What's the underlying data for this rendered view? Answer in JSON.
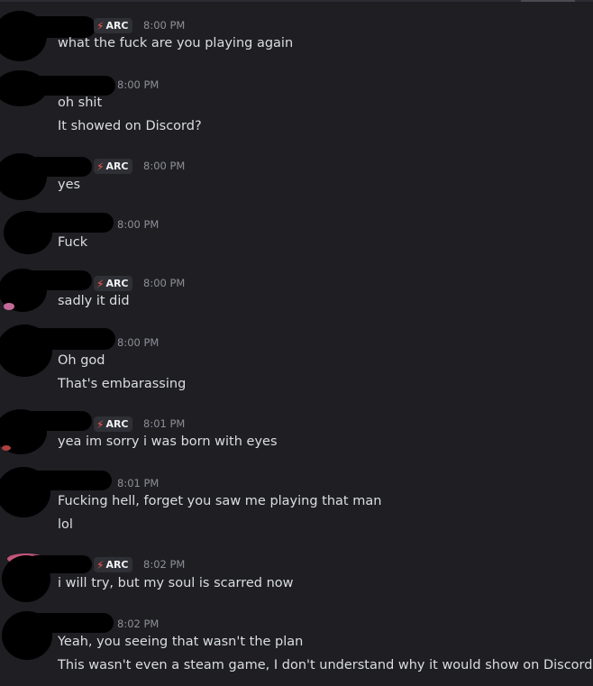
{
  "tag_label": "ARC",
  "messages": [
    {
      "time": "8:00 PM",
      "tagged": true,
      "lines": [
        "what the fuck are you playing again"
      ]
    },
    {
      "time": "8:00 PM",
      "tagged": false,
      "lines": [
        "oh shit",
        "It showed on Discord?"
      ]
    },
    {
      "time": "8:00 PM",
      "tagged": true,
      "lines": [
        "yes"
      ]
    },
    {
      "time": "8:00 PM",
      "tagged": false,
      "lines": [
        "Fuck"
      ]
    },
    {
      "time": "8:00 PM",
      "tagged": true,
      "lines": [
        "sadly it did"
      ]
    },
    {
      "time": "8:00 PM",
      "tagged": false,
      "lines": [
        "Oh god",
        "That's embarassing"
      ]
    },
    {
      "time": "8:01 PM",
      "tagged": true,
      "lines": [
        "yea im sorry i was born with eyes"
      ]
    },
    {
      "time": "8:01 PM",
      "tagged": false,
      "lines": [
        "Fucking hell, forget you saw me playing that man",
        "lol"
      ]
    },
    {
      "time": "8:02 PM",
      "tagged": true,
      "lines": [
        "i will try, but my soul is scarred now"
      ]
    },
    {
      "time": "8:02 PM",
      "tagged": false,
      "lines": [
        "Yeah, you seeing that wasn't the plan",
        "This wasn't even a steam game, I don't understand why it would show on Discord"
      ]
    }
  ],
  "colors": {
    "background": "#1e1e23",
    "text": "#dbdee1",
    "timestamp": "#8e9097",
    "tag_bolt": "#ff5a4f",
    "tag_bg": "#2f3036"
  }
}
